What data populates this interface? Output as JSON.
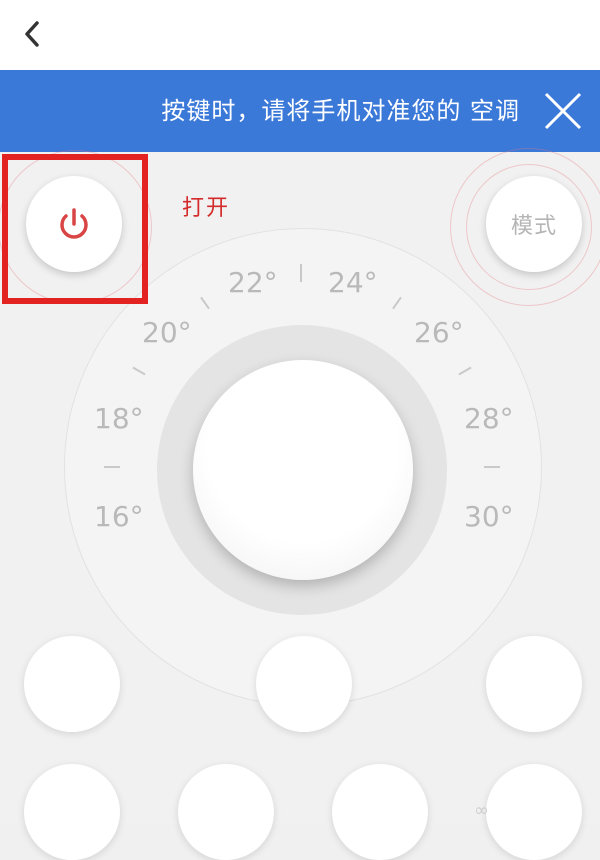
{
  "nav": {
    "back_icon": "chevron-left-icon"
  },
  "banner": {
    "text": "按键时，请将手机对准您的 空调",
    "close_icon": "close-icon",
    "color": "#3b79d9"
  },
  "controls": {
    "power": {
      "icon": "power-icon",
      "label": "打开",
      "icon_color": "#d94444"
    },
    "mode": {
      "label": "模式"
    }
  },
  "dial": {
    "temperatures": [
      "22°",
      "24°",
      "20°",
      "26°",
      "18°",
      "28°",
      "16°",
      "30°"
    ]
  },
  "partial_glyph": "∞"
}
